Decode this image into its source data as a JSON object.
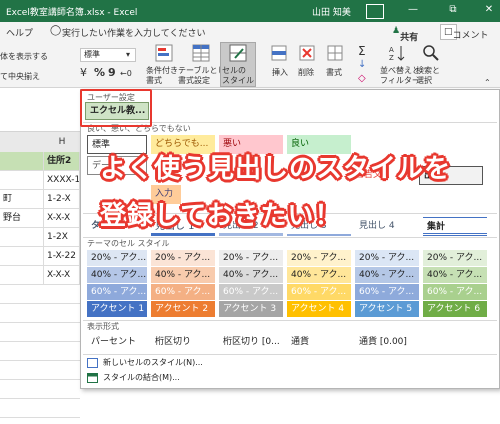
{
  "window": {
    "title": "Excel教室講師名簿.xlsx - Excel",
    "user": "山田 知美"
  },
  "ribbon_tabs": [
    "ヘルプ",
    "実行したい作業を入力してください"
  ],
  "ribbon_share": {
    "share": "共有",
    "comment": "コメント"
  },
  "ribbon_left": {
    "wrap": "体を表示する",
    "center": "て中央揃え"
  },
  "number_format": {
    "value": "標準",
    "percent": "%",
    "comma": "9"
  },
  "ribbon_groups": {
    "conditional": [
      "条件付き",
      "書式"
    ],
    "table": [
      "テーブルとして",
      "書式設定"
    ],
    "cell_style": [
      "セルの",
      "スタイル"
    ],
    "insert": "挿入",
    "delete": "削除",
    "format": "書式",
    "sort": [
      "並べ替えと",
      "フィルター"
    ],
    "find": [
      "検索と",
      "選択"
    ]
  },
  "grid": {
    "col_h": "H",
    "header_cell": "住所2",
    "col_g_cells": [
      "町",
      "野台"
    ],
    "col_h_cells": [
      "XXXX-1",
      "1-2-X",
      "X-X-X",
      "1-2X",
      "1-X-22",
      "X-X-X"
    ]
  },
  "gallery": {
    "user_section": "ユーザー設定",
    "user_style": "エクセル教...",
    "good_section": "良い、悪い、どちらでもない",
    "normal": "標準",
    "neutral": "どちらでも...",
    "bad": "悪い",
    "good": "良い",
    "data_frag": "データ",
    "warning_frag": "警告文",
    "output_frag": "出力",
    "input": "入力",
    "title_frag": "タ",
    "headings": [
      "見出し 1",
      "見出し 2",
      "見出し 3",
      "見出し 4",
      "集計"
    ],
    "theme_section": "テーマのセル スタイル",
    "accent_rows": [
      [
        "20% - アク...",
        "20% - アク...",
        "20% - アク...",
        "20% - アク...",
        "20% - アク...",
        "20% - アク..."
      ],
      [
        "40% - アク...",
        "40% - アク...",
        "40% - アク...",
        "40% - アク...",
        "40% - アク...",
        "40% - アク..."
      ],
      [
        "60% - アク...",
        "60% - アク...",
        "60% - アク...",
        "60% - アク...",
        "60% - アク...",
        "60% - アク..."
      ],
      [
        "アクセント 1",
        "アクセント 2",
        "アクセント 3",
        "アクセント 4",
        "アクセント 5",
        "アクセント 6"
      ]
    ],
    "number_section": "表示形式",
    "number_styles": [
      "パーセント",
      "桁区切り",
      "桁区切り [0...",
      "通貨",
      "通貨 [0.00]"
    ],
    "new_style": "新しいセルのスタイル(N)...",
    "merge_style": "スタイルの結合(M)..."
  },
  "callout": [
    "よく使う見出しのスタイルを",
    "登録しておきたい！"
  ],
  "colors": {
    "excel_green": "#217346",
    "highlight_red": "#e8382f",
    "accents": {
      "a20": [
        "#dde6f3",
        "#fbe4d6",
        "#ededed",
        "#fff2cc",
        "#dbe6f5",
        "#e2efda"
      ],
      "a40": [
        "#b4c6e7",
        "#f8cbad",
        "#dbdbdb",
        "#ffe699",
        "#b4c7e6",
        "#c6e0b4"
      ],
      "a60": [
        "#8ea9db",
        "#f4b084",
        "#c9c9c9",
        "#ffd966",
        "#8eaadb",
        "#a9d08e"
      ],
      "a100": [
        "#4472c4",
        "#ed7d31",
        "#a5a5a5",
        "#ffc000",
        "#5b9bd5",
        "#70ad47"
      ]
    }
  }
}
